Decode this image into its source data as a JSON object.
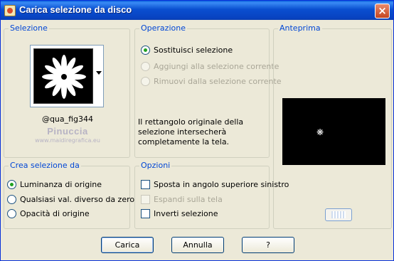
{
  "window": {
    "title": "Carica selezione da disco",
    "close_glyph": "×"
  },
  "selezione": {
    "label": "Selezione",
    "thumbnail_name": "@qua_fig344",
    "watermark_name": "Pinuccia",
    "watermark_url": "www.maidiregrafica.eu"
  },
  "operazione": {
    "label": "Operazione",
    "options": [
      {
        "label": "Sostituisci selezione",
        "checked": true,
        "enabled": true
      },
      {
        "label": "Aggiungi alla selezione corrente",
        "checked": false,
        "enabled": false
      },
      {
        "label": "Rimuovi dalla selezione corrente",
        "checked": false,
        "enabled": false
      }
    ],
    "info": "Il rettangolo originale della selezione intersecherà completamente la tela."
  },
  "anteprima": {
    "label": "Anteprima"
  },
  "crea": {
    "label": "Crea selezione da",
    "options": [
      {
        "label": "Luminanza di origine",
        "checked": true
      },
      {
        "label": "Qualsiasi val. diverso da zero",
        "checked": false
      },
      {
        "label": "Opacità di origine",
        "checked": false
      }
    ]
  },
  "opzioni": {
    "label": "Opzioni",
    "checks": [
      {
        "label": "Sposta in angolo superiore sinistro",
        "checked": false,
        "enabled": true
      },
      {
        "label": "Espandi sulla tela",
        "checked": false,
        "enabled": false
      },
      {
        "label": "Inverti selezione",
        "checked": false,
        "enabled": true
      }
    ]
  },
  "buttons": {
    "load": "Carica",
    "cancel": "Annulla",
    "help": "?"
  },
  "colors": {
    "group_label": "#0046d5",
    "title_bar": "#0a4fd0",
    "background": "#ece9d8"
  }
}
